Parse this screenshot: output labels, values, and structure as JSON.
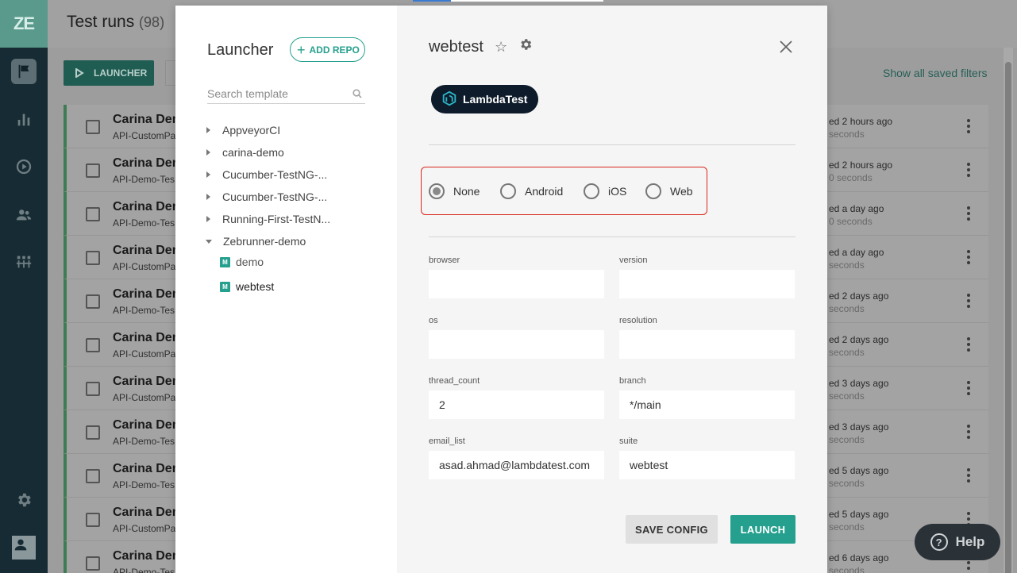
{
  "app": {
    "logo": "ZE"
  },
  "header": {
    "title": "Test runs",
    "count": "(98)"
  },
  "toolbar": {
    "launcher_label": "LAUNCHER",
    "saved_filters_label": "Show all saved filters"
  },
  "runs": [
    {
      "name": "Carina Dem",
      "sub": "API-CustomPa",
      "time": "ed 2 hours ago",
      "duration": "seconds"
    },
    {
      "name": "Carina Dem",
      "sub": "API-Demo-Tes",
      "time": "ed 2 hours ago",
      "duration": "0 seconds"
    },
    {
      "name": "Carina Dem",
      "sub": "API-Demo-Tes",
      "time": "ed a day ago",
      "duration": "0 seconds"
    },
    {
      "name": "Carina Dem",
      "sub": "API-CustomPa",
      "time": "ed a day ago",
      "duration": "seconds"
    },
    {
      "name": "Carina Dem",
      "sub": "API-Demo-Tes",
      "time": "ed 2 days ago",
      "duration": "seconds"
    },
    {
      "name": "Carina Dem",
      "sub": "API-CustomPa",
      "time": "ed 2 days ago",
      "duration": "seconds"
    },
    {
      "name": "Carina Dem",
      "sub": "API-CustomPa",
      "time": "ed 3 days ago",
      "duration": "seconds"
    },
    {
      "name": "Carina Dem",
      "sub": "API-Demo-Tes",
      "time": "ed 3 days ago",
      "duration": "seconds"
    },
    {
      "name": "Carina Dem",
      "sub": "API-Demo-Tes",
      "time": "ed 5 days ago",
      "duration": "seconds"
    },
    {
      "name": "Carina Dem",
      "sub": "API-CustomPa",
      "time": "ed 5 days ago",
      "duration": "seconds"
    },
    {
      "name": "Carina Dem",
      "sub": "API-Demo-Tes",
      "time": "ed 6 days ago",
      "duration": "seconds"
    }
  ],
  "help": {
    "label": "Help"
  },
  "launcher": {
    "title": "Launcher",
    "add_repo_label": "ADD REPO",
    "search_placeholder": "Search template",
    "repos": [
      {
        "label": "AppveyorCI",
        "expanded": false
      },
      {
        "label": "carina-demo",
        "expanded": false
      },
      {
        "label": "Cucumber-TestNG-...",
        "expanded": false
      },
      {
        "label": "Cucumber-TestNG-...",
        "expanded": false
      },
      {
        "label": "Running-First-TestN...",
        "expanded": false
      },
      {
        "label": "Zebrunner-demo",
        "expanded": true
      }
    ],
    "templates": [
      {
        "badge": "M",
        "label": "demo",
        "selected": false
      },
      {
        "badge": "M",
        "label": "webtest",
        "selected": true
      }
    ]
  },
  "template": {
    "title": "webtest",
    "provider_label": "LambdaTest",
    "platform_options": [
      {
        "label": "None",
        "checked": true
      },
      {
        "label": "Android",
        "checked": false
      },
      {
        "label": "iOS",
        "checked": false
      },
      {
        "label": "Web",
        "checked": false
      }
    ],
    "fields": {
      "browser": {
        "label": "browser",
        "value": ""
      },
      "version": {
        "label": "version",
        "value": ""
      },
      "os": {
        "label": "os",
        "value": ""
      },
      "resolution": {
        "label": "resolution",
        "value": ""
      },
      "thread_count": {
        "label": "thread_count",
        "value": "2"
      },
      "branch": {
        "label": "branch",
        "value": "*/main"
      },
      "email_list": {
        "label": "email_list",
        "value": "asad.ahmad@lambdatest.com"
      },
      "suite": {
        "label": "suite",
        "value": "webtest"
      }
    },
    "save_config_label": "SAVE CONFIG",
    "launch_label": "LAUNCH"
  },
  "colors": {
    "accent": "#26a08e",
    "sidebar_bg": "#162b33",
    "highlight_border": "#d9261c",
    "run_status": "#3e7d54"
  }
}
